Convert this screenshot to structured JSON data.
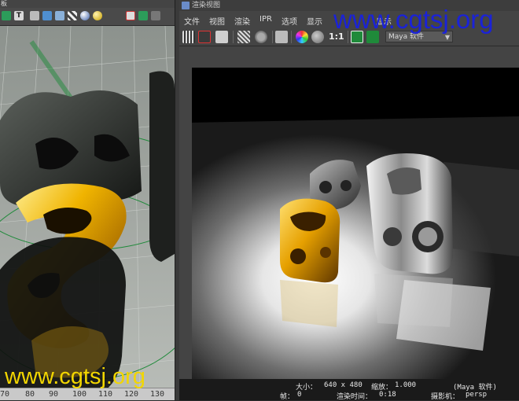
{
  "left_viewport": {
    "title": "板",
    "ruler_ticks": [
      "70",
      "80",
      "90",
      "100",
      "110",
      "120",
      "130"
    ]
  },
  "render_view": {
    "title": "渲染视图",
    "menu": [
      "文件",
      "视图",
      "渲染",
      "IPR",
      "选项",
      "显示",
      "显示"
    ],
    "ratio_button": "1:1",
    "renderer": "Maya 软件",
    "status": {
      "size_label": "大小：",
      "size_value": "640 x 480",
      "zoom_label": "缩放：",
      "zoom_value": "1.000",
      "renderer_note": "(Maya 软件)",
      "frame_label": "帧：",
      "frame_value": "0",
      "time_label": "渲染时间：",
      "time_value": "0:18",
      "camera_label": "摄影机：",
      "camera_value": "persp"
    }
  },
  "watermark": {
    "text_top": "www.cgtsj.org",
    "text_bottom": "www.cgtsj.org"
  },
  "colors": {
    "gold": "#f0b400",
    "blue_watermark": "#1a22d8",
    "yellow_watermark": "#f2d600"
  }
}
